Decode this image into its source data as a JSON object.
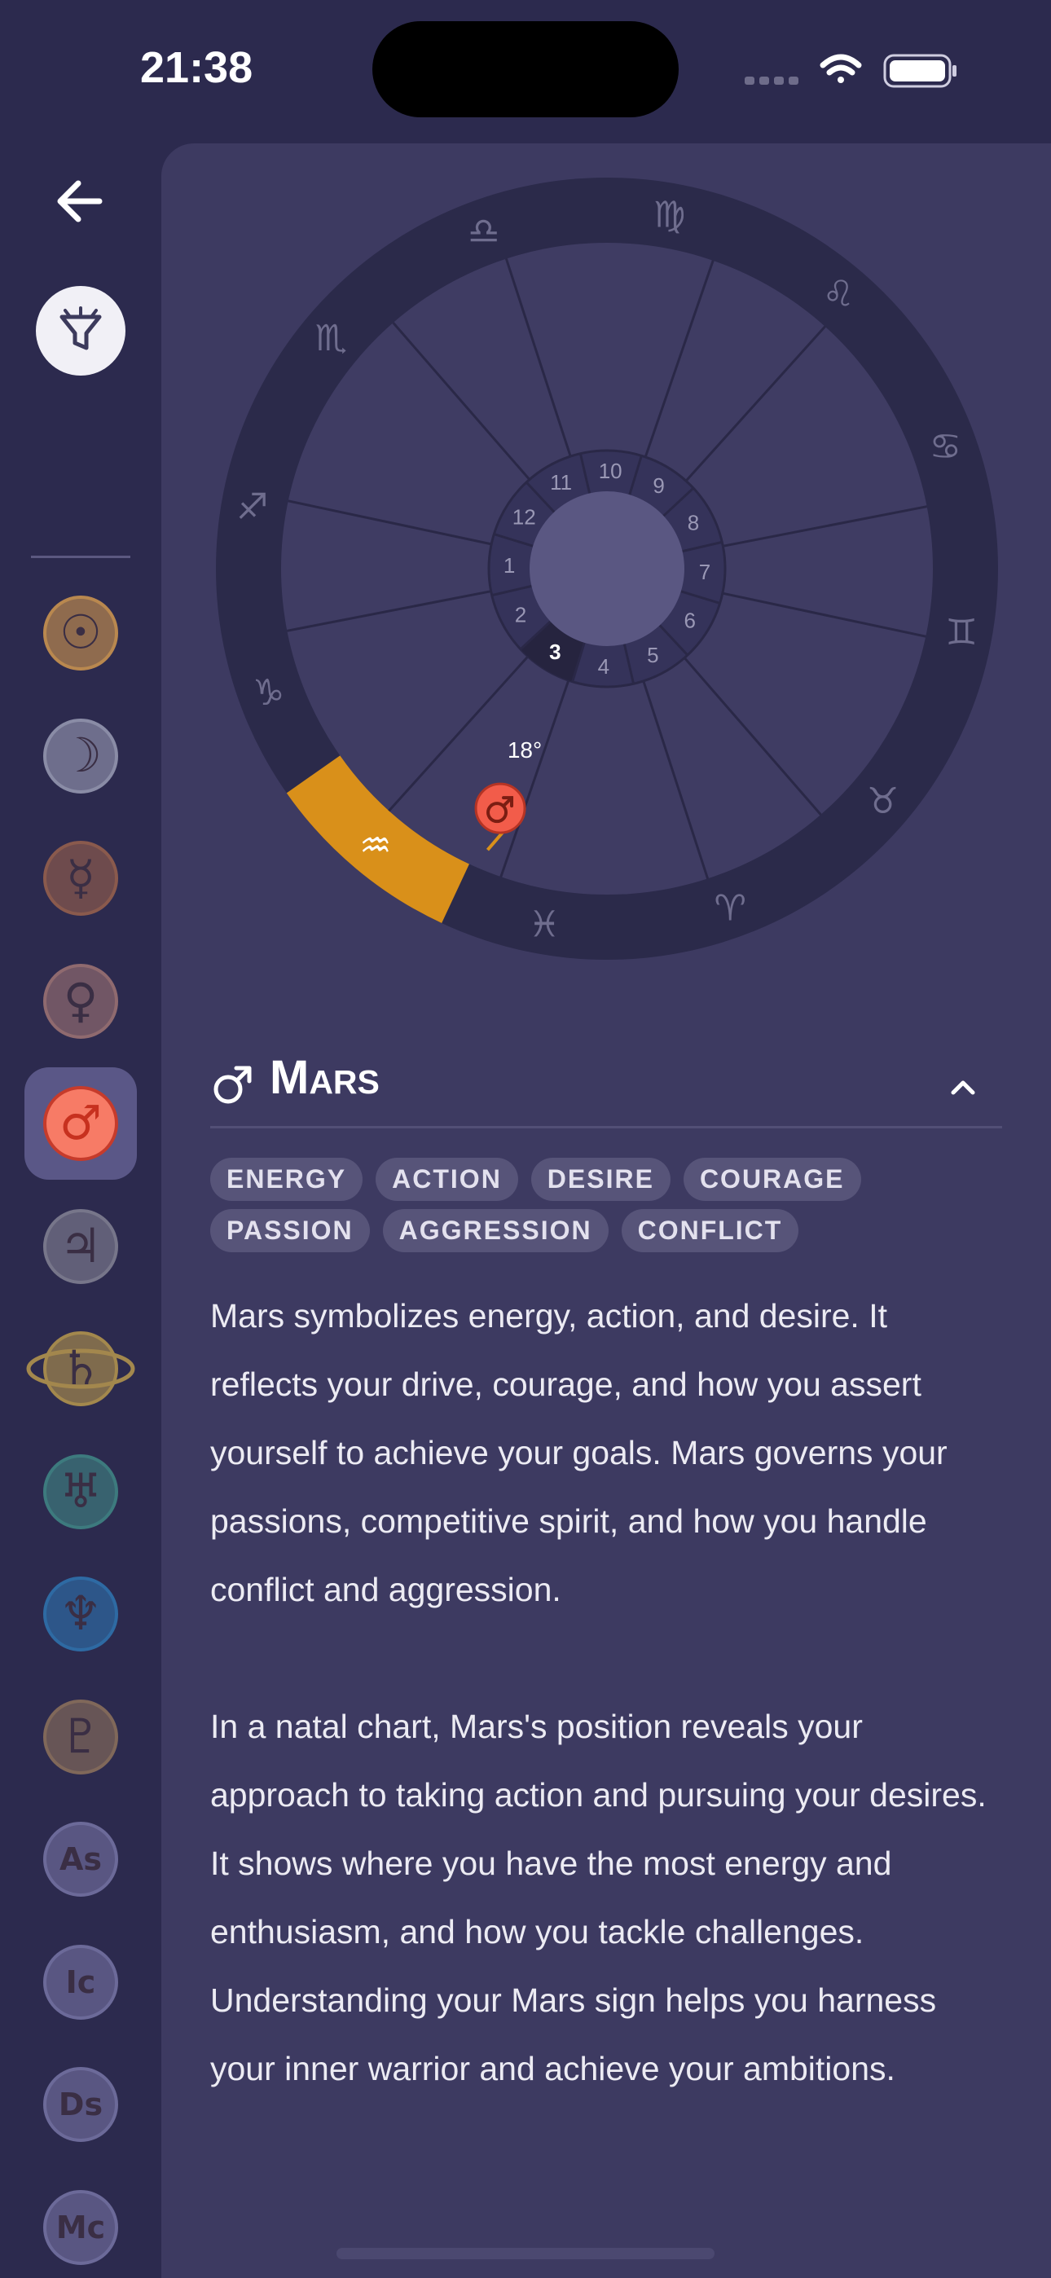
{
  "status_bar": {
    "time": "21:38"
  },
  "colors": {
    "background": "#2c2a4e",
    "panel": "#3d3a61",
    "wheel_ring": "#2b2a4a",
    "house_fill": "#3f3c63",
    "highlight_sign": "#d9901a",
    "mars_red": "#f25c4a"
  },
  "sidebar": {
    "back_icon": "arrow-left-icon",
    "filter_icon": "filter-icon",
    "items": [
      {
        "name": "sun",
        "glyph": "☉",
        "color": "#b9884f",
        "active": false
      },
      {
        "name": "moon",
        "glyph": "☽",
        "color": "#8a8ca6",
        "active": false
      },
      {
        "name": "mercury",
        "glyph": "☿",
        "color": "#8a5a4d",
        "active": false
      },
      {
        "name": "venus",
        "glyph": "♀",
        "color": "#8f6a6f",
        "active": false
      },
      {
        "name": "mars",
        "glyph": "♂",
        "color": "#f25c4a",
        "active": true
      },
      {
        "name": "jupiter",
        "glyph": "♃",
        "color": "#77768a",
        "active": false
      },
      {
        "name": "saturn",
        "glyph": "♄",
        "color": "#a3884d",
        "active": false
      },
      {
        "name": "uranus",
        "glyph": "♅",
        "color": "#3d7a7e",
        "active": false
      },
      {
        "name": "neptune",
        "glyph": "♆",
        "color": "#2e6aa3",
        "active": false
      },
      {
        "name": "pluto",
        "glyph": "♇",
        "color": "#80685a",
        "active": false
      },
      {
        "name": "ascendant",
        "glyph": "As",
        "color": "#6c6a99",
        "active": false
      },
      {
        "name": "imum-coeli",
        "glyph": "Ic",
        "color": "#6c6a99",
        "active": false
      },
      {
        "name": "descendant",
        "glyph": "Ds",
        "color": "#6c6a99",
        "active": false
      },
      {
        "name": "midheaven",
        "glyph": "Mc",
        "color": "#6c6a99",
        "active": false
      }
    ]
  },
  "wheel": {
    "zodiac_signs": [
      "♍",
      "♌",
      "♋",
      "♊",
      "♉",
      "♈",
      "♓",
      "♒",
      "♑",
      "♐",
      "♏",
      "♎"
    ],
    "highlighted_sign": "♒",
    "houses": [
      "10",
      "9",
      "8",
      "7",
      "6",
      "5",
      "4",
      "3",
      "2",
      "1",
      "12",
      "11"
    ],
    "highlighted_house": "3",
    "planet_glyph": "♂",
    "planet_degree": "18°"
  },
  "detail": {
    "glyph": "♂",
    "title": "Mars",
    "collapse_icon": "chevron-up-icon",
    "tags": [
      "ENERGY",
      "ACTION",
      "DESIRE",
      "COURAGE",
      "PASSION",
      "AGGRESSION",
      "CONFLICT"
    ],
    "paragraphs": [
      "Mars symbolizes energy, action, and desire. It reflects your drive, courage, and how you assert yourself to achieve your goals. Mars governs your passions, competitive spirit, and how you handle conflict and aggression.",
      "In a natal chart, Mars's position reveals your approach to taking action and pursuing your desires. It shows where you have the most energy and enthusiasm, and how you tackle challenges. Understanding your Mars sign helps you harness your inner warrior and achieve your ambitions."
    ]
  }
}
